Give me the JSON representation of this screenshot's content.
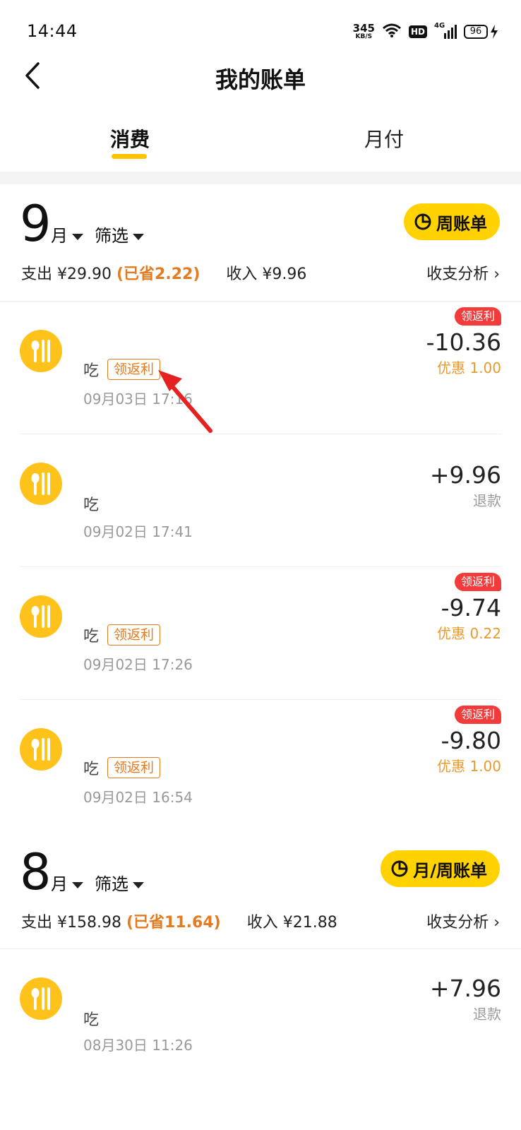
{
  "status_bar": {
    "time": "14:44",
    "net_speed_value": "345",
    "net_speed_unit": "KB/S",
    "hd_label": "HD",
    "network_type": "4G",
    "battery_level": "96"
  },
  "header": {
    "title": "我的账单"
  },
  "tabs": [
    {
      "label": "消费",
      "active": true
    },
    {
      "label": "月付",
      "active": false
    }
  ],
  "months": [
    {
      "month_number": "9",
      "month_unit": "月",
      "filter_label": "筛选",
      "bill_button_label": "周账单",
      "expense_label": "支出",
      "expense_amount": "¥29.90",
      "saved_text": "(已省2.22)",
      "income_label": "收入",
      "income_amount": "¥9.96",
      "analysis_label": "收支分析 ›",
      "transactions": [
        {
          "category": "吃",
          "tag": "领返利",
          "date": "09月03日 17:16",
          "badge": "领返利",
          "amount": "-10.36",
          "sub": "优惠 1.00",
          "sub_type": "discount"
        },
        {
          "category": "吃",
          "tag": "",
          "date": "09月02日 17:41",
          "badge": "",
          "amount": "+9.96",
          "sub": "退款",
          "sub_type": "refund"
        },
        {
          "category": "吃",
          "tag": "领返利",
          "date": "09月02日 17:26",
          "badge": "领返利",
          "amount": "-9.74",
          "sub": "优惠 0.22",
          "sub_type": "discount"
        },
        {
          "category": "吃",
          "tag": "领返利",
          "date": "09月02日 16:54",
          "badge": "领返利",
          "amount": "-9.80",
          "sub": "优惠 1.00",
          "sub_type": "discount"
        }
      ]
    },
    {
      "month_number": "8",
      "month_unit": "月",
      "filter_label": "筛选",
      "bill_button_label": "月/周账单",
      "expense_label": "支出",
      "expense_amount": "¥158.98",
      "saved_text": "(已省11.64)",
      "income_label": "收入",
      "income_amount": "¥21.88",
      "analysis_label": "收支分析 ›",
      "transactions": [
        {
          "category": "吃",
          "tag": "",
          "date": "08月30日 11:26",
          "badge": "",
          "amount": "+7.96",
          "sub": "退款",
          "sub_type": "refund"
        }
      ]
    }
  ],
  "colors": {
    "accent_yellow": "#FFD200",
    "tag_orange": "#E67A1F",
    "badge_red": "#F23C3C",
    "annotation_red": "#E52222"
  }
}
